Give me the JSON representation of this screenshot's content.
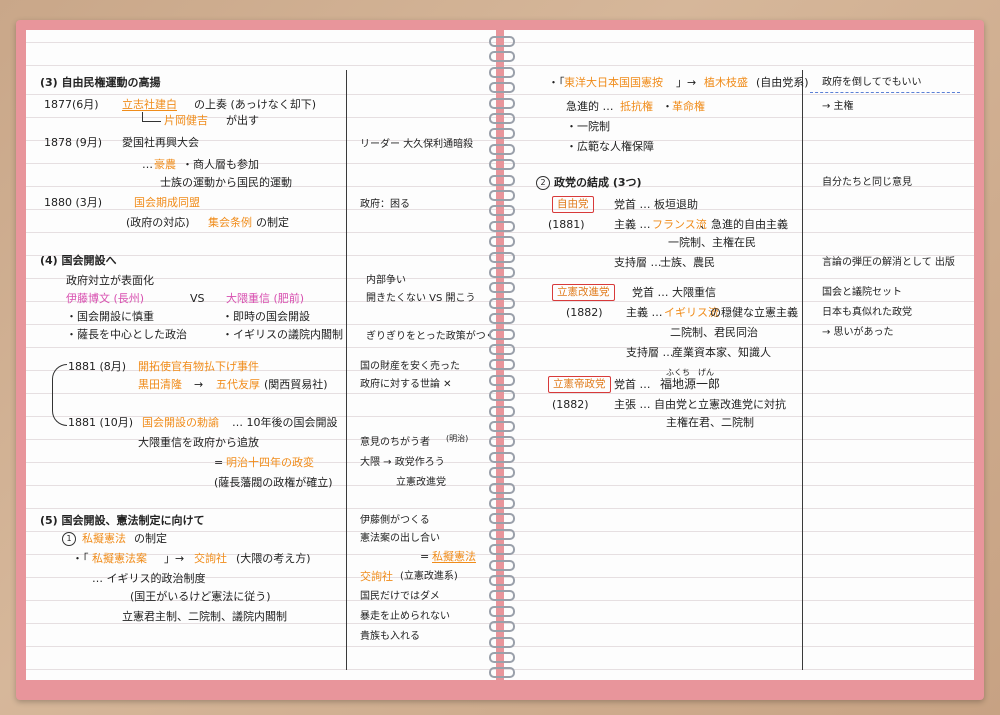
{
  "left": {
    "sec3_title": "(3) 自由民権運動の高揚",
    "l1_date": "1877(6月)",
    "l1_org": "立志社建白",
    "l1_rest": "の上奏 (あっけなく却下)",
    "l2_org": "片岡健吉",
    "l2_rest": "が出す",
    "l3_date": "1878 (9月)",
    "l3_text": "愛国社再興大会",
    "l3_note": "リーダー 大久保利通暗殺",
    "l4_a": "… ",
    "l4_org": "豪農",
    "l4_rest": "・商人層も参加",
    "l5_text": "士族の運動から国民的運動",
    "l6_date": "1880 (3月)",
    "l6_org": "国会期成同盟",
    "l6_note": "政府：困る",
    "l7_a": "(政府の対応)",
    "l7_org": "集会条例",
    "l7_rest": "の制定",
    "sec4_title": "(4) 国会開設へ",
    "l8_text": "政府対立が表面化",
    "l8_note": "内部争い",
    "l9_a": "伊藤博文 (長州)",
    "l9_vs": "VS",
    "l9_b": "大隈重信 (肥前)",
    "l9_note": "開きたくない VS 開こう",
    "l10_a": "・国会開設に慎重",
    "l10_b": "・即時の国会開設",
    "l11_a": "・薩長を中心とした政治",
    "l11_b": "・イギリスの議院内閣制",
    "l11_note": "ぎりぎりをとった政策がつくる",
    "l12_date": "1881 (8月)",
    "l12_org": "開拓使官有物払下げ事件",
    "l12_note": "国の財産を安く売った",
    "l13_org": "黒田清隆",
    "l13_arrow": "→",
    "l13_org2": "五代友厚",
    "l13_rest": "(関西貿易社)",
    "l13_note": "政府に対する世論 ✕",
    "l14_date": "1881 (10月)",
    "l14_org": "国会開設の勅諭",
    "l14_rest": "… 10年後の国会開設",
    "l15_text": "大隈重信を政府から追放",
    "l15_note": "意見のちがう者",
    "l15_small": "(明治)",
    "l16_a": "=",
    "l16_org": "明治十四年の政変",
    "l16_note": "大隈 → 政党作ろう",
    "l17_text": "(薩長藩閥の政権が確立)",
    "l17_note": "立憲改進党",
    "sec5_title": "(5) 国会開設、憲法制定に向けて",
    "sec5_note": "伊藤側がつくる",
    "c1_num": "1",
    "c1_org": "私擬憲法",
    "c1_rest": "の制定",
    "c1_note": "憲法案の出し合い",
    "l18_a": "・「",
    "l18_org": "私擬憲法案",
    "l18_b": "」→",
    "l18_org2": "交詢社",
    "l18_rest": "(大隈の考え方)",
    "l18_note_a": "=",
    "l18_note_org": "私擬憲法",
    "l19_text": "… イギリス的政治制度",
    "l19_org": "交詢社",
    "l19_note": "(立憲改進系)",
    "l20_text": "(国王がいるけど憲法に従う)",
    "l20_note": "国民だけではダメ",
    "l21_text": "立憲君主制、二院制、議院内閣制",
    "l21_note": "暴走を止められない",
    "l22_note": "貴族も入れる"
  },
  "right": {
    "r1_a": "・「",
    "r1_org": "東洋大日本国国憲按",
    "r1_b": "」→",
    "r1_org2": "植木枝盛",
    "r1_rest": "(自由党系)",
    "r1_note": "政府を倒してでもいい",
    "r2_a": "急進的 …",
    "r2_org": "抵抗権",
    "r2_sep": "・",
    "r2_org2": "革命権",
    "r2_note": "→ 主権",
    "r3_text": "・一院制",
    "r4_text": "・広範な人権保障",
    "sec2_num": "2",
    "sec2_title": "政党の結成 (3つ)",
    "sec2_note": "自分たちと同じ意見",
    "p1_box": "自由党",
    "p1_a": "党首 … 板垣退助",
    "p1_year": "(1881)",
    "p1_b_label": "主義 …",
    "p1_b_org": "フランス流",
    "p1_b_rest": "、急進的自由主義",
    "p1_c": "一院制、主権在民",
    "p1_d_label": "支持層 …",
    "p1_d": "士族、農民",
    "p1_d_note": "言論の弾圧の解消として 出版",
    "p2_box": "立憲改進党",
    "p2_a": "党首 … 大隈重信",
    "p2_note1": "国会と議院セット",
    "p2_year": "(1882)",
    "p2_b_label": "主義 …",
    "p2_b_org": "イギリス流",
    "p2_b_rest": "の穏健な立憲主義",
    "p2_note2": "日本も真似れた政党",
    "p2_c": "二院制、君民同治",
    "p2_note3": "→ 思いがあった",
    "p2_d_label": "支持層 …",
    "p2_d": "産業資本家、知識人",
    "p3_box": "立憲帝政党",
    "p3_a_label": "党首 …",
    "p3_ruby": "ふくち　げん",
    "p3_a": "福地源一郎",
    "p3_year": "(1882)",
    "p3_b": "主張 … 自由党と立憲改進党に対抗",
    "p3_c": "主権在君、二院制"
  }
}
